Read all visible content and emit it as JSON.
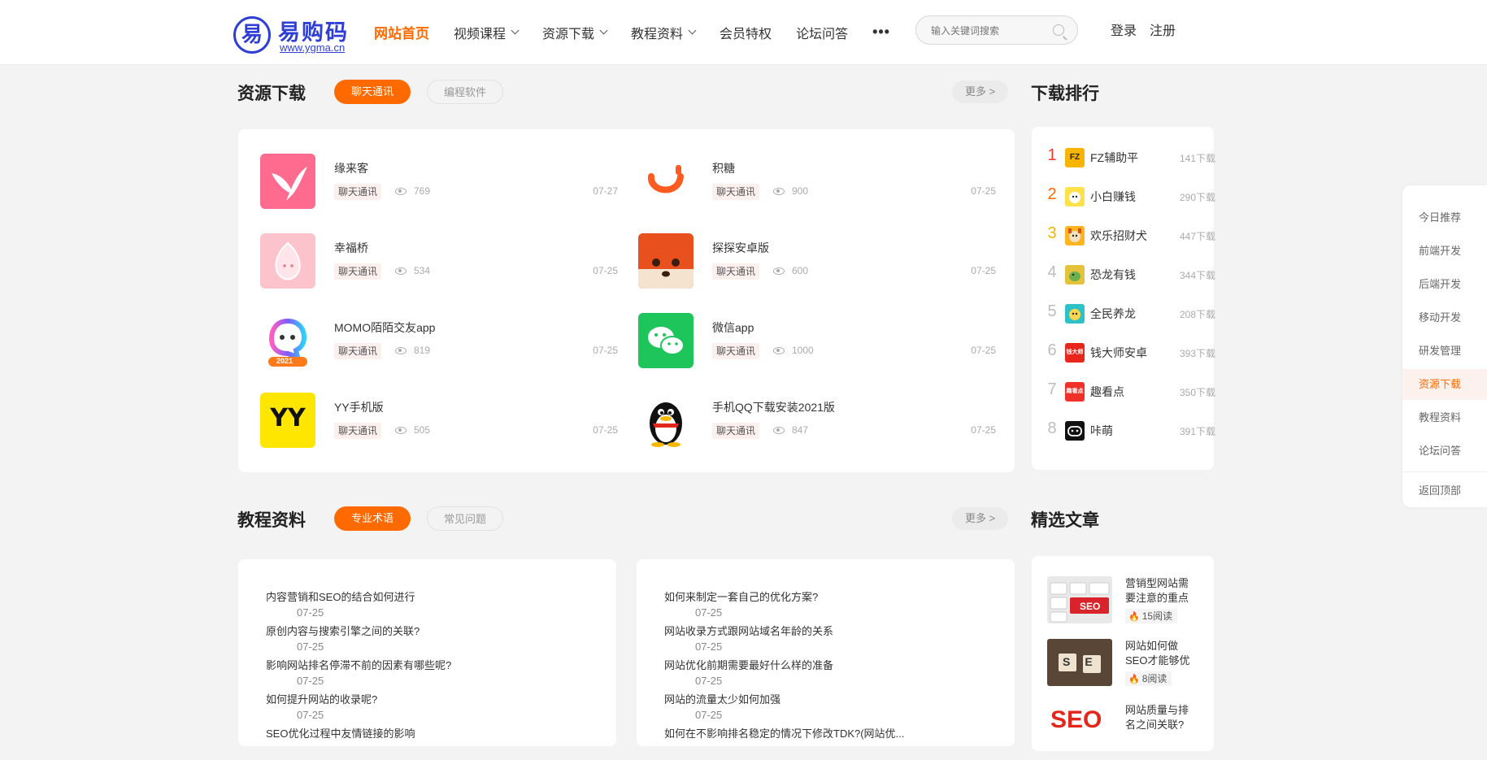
{
  "header": {
    "logo_text": "易购码",
    "logo_url": "www.ygma.cn",
    "nav": [
      {
        "label": "网站首页"
      },
      {
        "label": "视频课程"
      },
      {
        "label": "资源下载"
      },
      {
        "label": "教程资料"
      },
      {
        "label": "会员特权"
      },
      {
        "label": "论坛问答"
      }
    ],
    "search_placeholder": "输入关键词搜索",
    "login": "登录",
    "register": "注册"
  },
  "resources": {
    "title": "资源下载",
    "tabs": [
      "聊天通讯",
      "编程软件"
    ],
    "more": "更多 >",
    "items": [
      {
        "name": "缘来客",
        "tag": "聊天通讯",
        "views": "769",
        "date": "07-27"
      },
      {
        "name": "积糖",
        "tag": "聊天通讯",
        "views": "900",
        "date": "07-25"
      },
      {
        "name": "幸福桥",
        "tag": "聊天通讯",
        "views": "534",
        "date": "07-25"
      },
      {
        "name": "探探安卓版",
        "tag": "聊天通讯",
        "views": "600",
        "date": "07-25"
      },
      {
        "name": "MOMO陌陌交友app",
        "tag": "聊天通讯",
        "views": "819",
        "date": "07-25"
      },
      {
        "name": "微信app",
        "tag": "聊天通讯",
        "views": "1000",
        "date": "07-25"
      },
      {
        "name": "YY手机版",
        "tag": "聊天通讯",
        "views": "505",
        "date": "07-25"
      },
      {
        "name": "手机QQ下载安装2021版",
        "tag": "聊天通讯",
        "views": "847",
        "date": "07-25"
      }
    ],
    "icon_texts": {
      "yy": "YY",
      "momo_year": "2021"
    }
  },
  "ranking": {
    "title": "下载排行",
    "items": [
      {
        "rank": "1",
        "name": "FZ辅助平",
        "count": "141下载",
        "icon_text": "FZ",
        "color": "#f23c2c"
      },
      {
        "rank": "2",
        "name": "小白赚钱",
        "count": "290下载",
        "icon_text": "",
        "color": "#ff6a00"
      },
      {
        "rank": "3",
        "name": "欢乐招财犬",
        "count": "447下载",
        "icon_text": "",
        "color": "#f7b500"
      },
      {
        "rank": "4",
        "name": "恐龙有钱",
        "count": "344下载",
        "icon_text": "",
        "color": "#bdbdbd"
      },
      {
        "rank": "5",
        "name": "全民养龙",
        "count": "208下载",
        "icon_text": "",
        "color": "#bdbdbd"
      },
      {
        "rank": "6",
        "name": "钱大师安卓",
        "count": "393下载",
        "icon_text": "钱大师",
        "color": "#bdbdbd"
      },
      {
        "rank": "7",
        "name": "趣看点",
        "count": "350下载",
        "icon_text": "趣看点",
        "color": "#bdbdbd"
      },
      {
        "rank": "8",
        "name": "咔萌",
        "count": "391下载",
        "icon_text": "",
        "color": "#bdbdbd"
      }
    ]
  },
  "float_menu": {
    "items": [
      "今日推荐",
      "前端开发",
      "后端开发",
      "移动开发",
      "研发管理",
      "资源下载",
      "教程资料",
      "论坛问答"
    ],
    "back_top": "返回顶部"
  },
  "tutorials": {
    "title": "教程资料",
    "tabs": [
      "专业术语",
      "常见问题"
    ],
    "more": "更多 >",
    "left": [
      {
        "title": "内容营销和SEO的结合如何进行",
        "date": "07-25"
      },
      {
        "title": "原创内容与搜索引擎之间的关联?",
        "date": "07-25"
      },
      {
        "title": "影响网站排名停滞不前的因素有哪些呢?",
        "date": "07-25"
      },
      {
        "title": "如何提升网站的收录呢?",
        "date": "07-25"
      },
      {
        "title": "SEO优化过程中友情链接的影响",
        "date": ""
      }
    ],
    "right": [
      {
        "title": "如何来制定一套自己的优化方案?",
        "date": "07-25"
      },
      {
        "title": "网站收录方式跟网站域名年龄的关系",
        "date": "07-25"
      },
      {
        "title": "网站优化前期需要最好什么样的准备",
        "date": "07-25"
      },
      {
        "title": "网站的流量太少如何加强",
        "date": "07-25"
      },
      {
        "title": "如何在不影响排名稳定的情况下修改TDK?(网站优...",
        "date": ""
      }
    ]
  },
  "featured": {
    "title": "精选文章",
    "items": [
      {
        "title": "营销型网站需要注意的重点",
        "reads": "15阅读",
        "thumb_text": "SEO"
      },
      {
        "title": "网站如何做SEO才能够优",
        "reads": "8阅读",
        "thumb_text": "SE"
      },
      {
        "title": "网站质量与排名之间关联?",
        "reads": "",
        "thumb_text": "SEO"
      }
    ]
  },
  "colors": {
    "accent": "#ff6a00",
    "brand": "#2f3fd6"
  }
}
